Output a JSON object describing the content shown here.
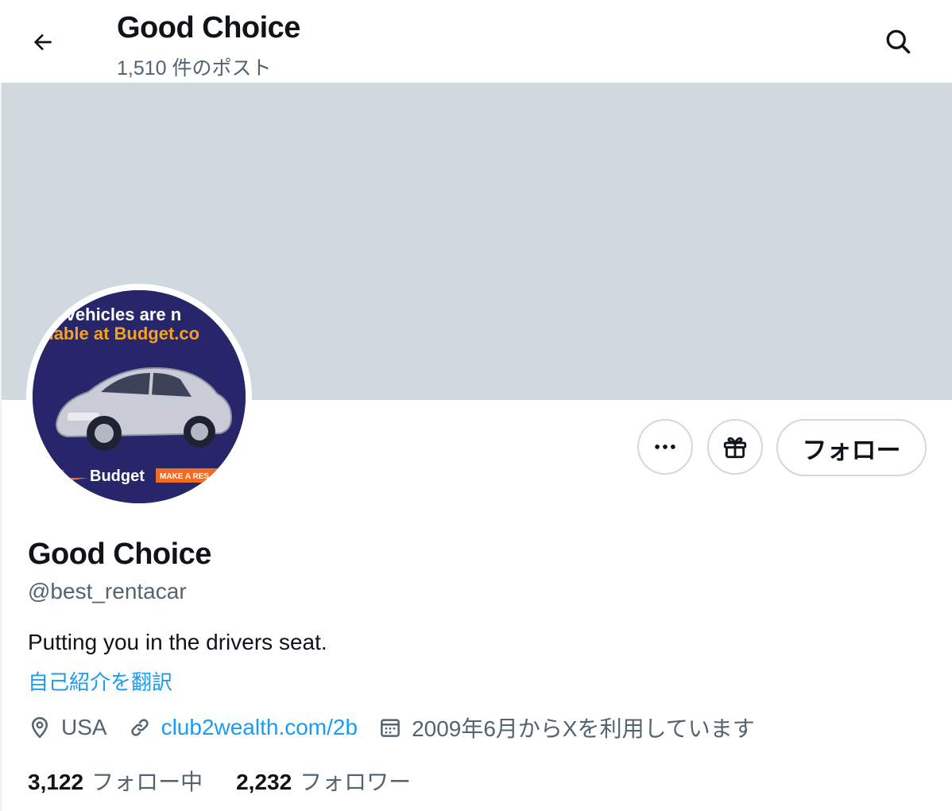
{
  "header": {
    "title": "Good Choice",
    "post_count": "1,510 件のポスト",
    "back_icon": "arrow-left-icon",
    "search_icon": "search-icon"
  },
  "banner": {
    "color": "#cfd9de"
  },
  "avatar": {
    "line1": "brid vehicles are n",
    "line2": "vailable at Budget.co",
    "brand": "Budget",
    "cta": "MAKE A RES"
  },
  "actions": {
    "more_icon": "more-icon",
    "gift_icon": "gift-icon",
    "follow_label": "フォロー"
  },
  "profile": {
    "name": "Good Choice",
    "handle": "@best_rentacar",
    "bio": "Putting you in the drivers seat.",
    "translate_label": "自己紹介を翻訳",
    "location": "USA",
    "website": "club2wealth.com/2b",
    "joined": "2009年6月からXを利用しています"
  },
  "stats": {
    "following_count": "3,122",
    "following_label": "フォロー中",
    "followers_count": "2,232",
    "followers_label": "フォロワー"
  },
  "colors": {
    "accent": "#1d9bf0",
    "secondary_text": "#536471",
    "border": "#cfd9de"
  }
}
